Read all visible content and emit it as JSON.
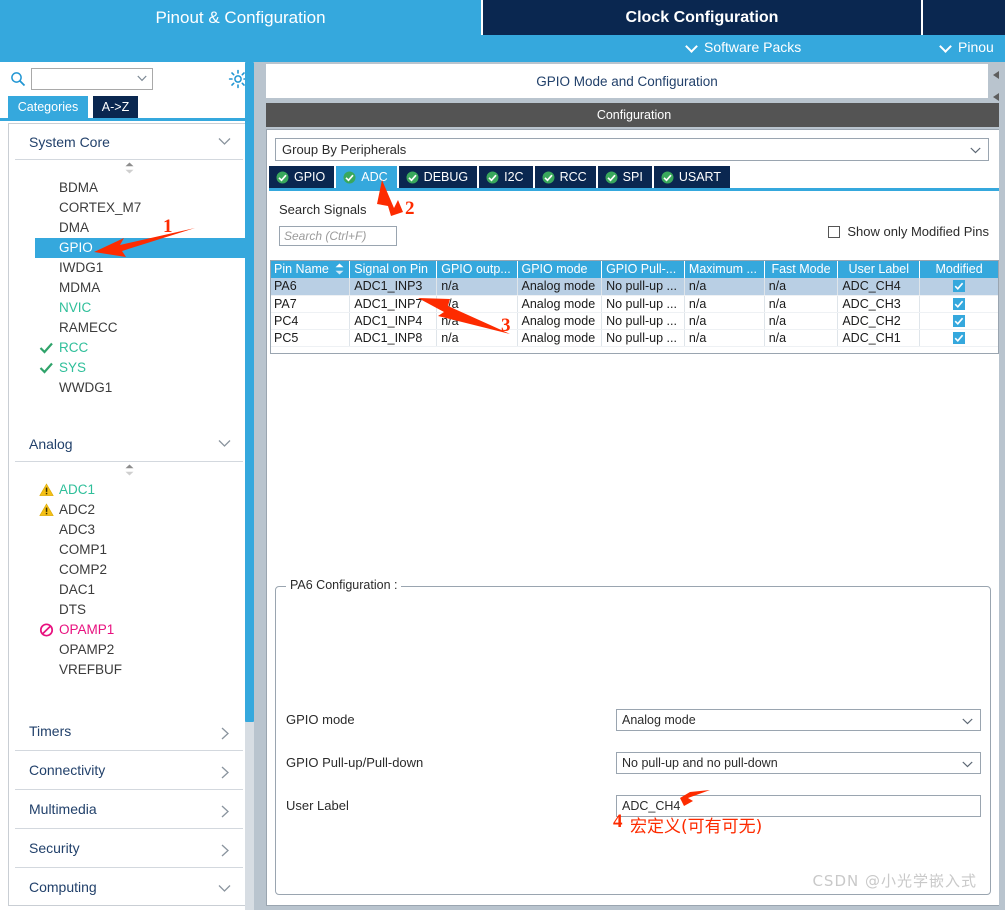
{
  "top_tabs": [
    {
      "label": "Pinout & Configuration",
      "selected": true
    },
    {
      "label": "Clock Configuration",
      "selected": false
    },
    {
      "label": "",
      "selected": false
    }
  ],
  "sub_menu": [
    {
      "label": "Software Packs",
      "icon": "chevron-down-icon"
    },
    {
      "label": "Pinou",
      "icon": "chevron-down-icon"
    }
  ],
  "left_panel": {
    "search": {
      "value": "",
      "placeholder": ""
    },
    "search_icon": "search-icon",
    "gear_icon": "gear-icon",
    "tabs": [
      {
        "label": "Categories",
        "selected": true
      },
      {
        "label": "A->Z",
        "selected": false
      }
    ],
    "groups": [
      {
        "title": "System Core",
        "expanded": true,
        "items": [
          {
            "label": "BDMA",
            "state": "normal",
            "mark": "none"
          },
          {
            "label": "CORTEX_M7",
            "state": "normal",
            "mark": "none"
          },
          {
            "label": "DMA",
            "state": "normal",
            "mark": "none"
          },
          {
            "label": "GPIO",
            "state": "selected",
            "mark": "none"
          },
          {
            "label": "IWDG1",
            "state": "normal",
            "mark": "none"
          },
          {
            "label": "MDMA",
            "state": "normal",
            "mark": "none"
          },
          {
            "label": "NVIC",
            "state": "green",
            "mark": "none"
          },
          {
            "label": "RAMECC",
            "state": "normal",
            "mark": "none"
          },
          {
            "label": "RCC",
            "state": "green",
            "mark": "check"
          },
          {
            "label": "SYS",
            "state": "green",
            "mark": "check"
          },
          {
            "label": "WWDG1",
            "state": "normal",
            "mark": "none"
          }
        ]
      },
      {
        "title": "Analog",
        "expanded": true,
        "items": [
          {
            "label": "ADC1",
            "state": "green",
            "mark": "warning"
          },
          {
            "label": "ADC2",
            "state": "normal",
            "mark": "warning"
          },
          {
            "label": "ADC3",
            "state": "normal",
            "mark": "none"
          },
          {
            "label": "COMP1",
            "state": "normal",
            "mark": "none"
          },
          {
            "label": "COMP2",
            "state": "normal",
            "mark": "none"
          },
          {
            "label": "DAC1",
            "state": "normal",
            "mark": "none"
          },
          {
            "label": "DTS",
            "state": "normal",
            "mark": "none"
          },
          {
            "label": "OPAMP1",
            "state": "pink",
            "mark": "forbidden"
          },
          {
            "label": "OPAMP2",
            "state": "normal",
            "mark": "none"
          },
          {
            "label": "VREFBUF",
            "state": "normal",
            "mark": "none"
          }
        ]
      }
    ],
    "collapsed_groups": [
      {
        "title": "Timers",
        "expanded": false
      },
      {
        "title": "Connectivity",
        "expanded": false
      },
      {
        "title": "Multimedia",
        "expanded": false
      },
      {
        "title": "Security",
        "expanded": false
      },
      {
        "title": "Computing",
        "expanded": true
      }
    ]
  },
  "right_panel": {
    "mode_title": "GPIO Mode and Configuration",
    "configuration_band": "Configuration",
    "group_by": {
      "value": "Group By Peripherals"
    },
    "peripheral_tabs": [
      {
        "label": "GPIO",
        "selected": false,
        "icon": "check-circle-icon"
      },
      {
        "label": "ADC",
        "selected": true,
        "icon": "check-circle-icon"
      },
      {
        "label": "DEBUG",
        "selected": false,
        "icon": "check-circle-icon"
      },
      {
        "label": "I2C",
        "selected": false,
        "icon": "check-circle-icon"
      },
      {
        "label": "RCC",
        "selected": false,
        "icon": "check-circle-icon"
      },
      {
        "label": "SPI",
        "selected": false,
        "icon": "check-circle-icon"
      },
      {
        "label": "USART",
        "selected": false,
        "icon": "check-circle-icon"
      }
    ],
    "search_signals_label": "Search Signals",
    "search_signals": {
      "value": "",
      "placeholder": "Search (Ctrl+F)"
    },
    "show_only_modified": {
      "label": "Show only Modified Pins",
      "checked": false
    },
    "table": {
      "columns": [
        "Pin Name",
        "Signal on Pin",
        "GPIO outp...",
        "GPIO mode",
        "GPIO Pull-...",
        "Maximum ...",
        "Fast Mode",
        "User Label",
        "Modified"
      ],
      "rows": [
        {
          "selected": true,
          "cells": [
            "PA6",
            "ADC1_INP3",
            "n/a",
            "Analog mode",
            "No pull-up ...",
            "n/a",
            "n/a",
            "ADC_CH4"
          ],
          "modified": true
        },
        {
          "selected": false,
          "cells": [
            "PA7",
            "ADC1_INP7",
            "n/a",
            "Analog mode",
            "No pull-up ...",
            "n/a",
            "n/a",
            "ADC_CH3"
          ],
          "modified": true
        },
        {
          "selected": false,
          "cells": [
            "PC4",
            "ADC1_INP4",
            "n/a",
            "Analog mode",
            "No pull-up ...",
            "n/a",
            "n/a",
            "ADC_CH2"
          ],
          "modified": true
        },
        {
          "selected": false,
          "cells": [
            "PC5",
            "ADC1_INP8",
            "n/a",
            "Analog mode",
            "No pull-up ...",
            "n/a",
            "n/a",
            "ADC_CH1"
          ],
          "modified": true
        }
      ]
    },
    "pin_config": {
      "legend": "PA6 Configuration :",
      "fields": [
        {
          "label": "GPIO mode",
          "value": "Analog mode",
          "type": "select"
        },
        {
          "label": "GPIO Pull-up/Pull-down",
          "value": "No pull-up and no pull-down",
          "type": "select"
        },
        {
          "label": "User Label",
          "value": "ADC_CH4",
          "type": "text"
        }
      ]
    }
  },
  "annotations": [
    {
      "id": "1",
      "text": "1"
    },
    {
      "id": "2",
      "text": "2"
    },
    {
      "id": "3",
      "text": "3"
    },
    {
      "id": "4",
      "text": "4"
    },
    {
      "id": "note",
      "text": "宏定义(可有可无)"
    }
  ],
  "watermark": "CSDN @小光学嵌入式",
  "colors": {
    "accent_blue": "#35a8dd",
    "navy": "#0a2750",
    "annotation_red": "#fd2b00",
    "green": "#2fbf9a",
    "pink": "#e8117f",
    "warning_yellow": "#f5c016",
    "band_gray": "#545454",
    "row_selected": "#b9cfe4"
  }
}
